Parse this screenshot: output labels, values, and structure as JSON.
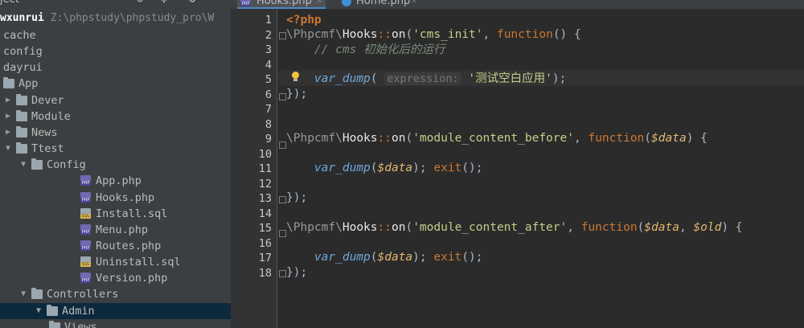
{
  "project": {
    "title": "ject",
    "root_name": "wxunrui",
    "root_path": "Z:\\phpstudy\\phpstudy_pro\\W",
    "items": [
      {
        "label": "cache",
        "kind": "none",
        "depth": 0,
        "open": false
      },
      {
        "label": "config",
        "kind": "none",
        "depth": 0,
        "open": false
      },
      {
        "label": "dayrui",
        "kind": "none",
        "depth": 0,
        "open": false
      },
      {
        "label": "App",
        "kind": "folder",
        "depth": 0,
        "open": true,
        "nochev": true
      },
      {
        "label": "Dever",
        "kind": "folder",
        "depth": 0,
        "open": false
      },
      {
        "label": "Module",
        "kind": "folder",
        "depth": 0,
        "open": false
      },
      {
        "label": "News",
        "kind": "folder",
        "depth": 0,
        "open": false
      },
      {
        "label": "Ttest",
        "kind": "folder",
        "depth": 0,
        "open": true
      },
      {
        "label": "Config",
        "kind": "folder",
        "depth": 1,
        "open": true
      },
      {
        "label": "App.php",
        "kind": "php",
        "depth": 2
      },
      {
        "label": "Hooks.php",
        "kind": "php",
        "depth": 2
      },
      {
        "label": "Install.sql",
        "kind": "sql",
        "depth": 2
      },
      {
        "label": "Menu.php",
        "kind": "php",
        "depth": 2
      },
      {
        "label": "Routes.php",
        "kind": "php",
        "depth": 2
      },
      {
        "label": "Uninstall.sql",
        "kind": "sql",
        "depth": 2
      },
      {
        "label": "Version.php",
        "kind": "php",
        "depth": 2
      },
      {
        "label": "Controllers",
        "kind": "folder",
        "depth": 1,
        "open": true
      },
      {
        "label": "Admin",
        "kind": "folder",
        "depth": 2,
        "open": true,
        "selected": true
      },
      {
        "label": "Views",
        "kind": "folder",
        "depth": 3,
        "open": false,
        "nochev": true
      }
    ]
  },
  "tabs": [
    {
      "label": "Hooks.php",
      "icon": "php-file-icon",
      "active": true
    },
    {
      "label": "Home.php",
      "icon": "php-class-icon",
      "active": false
    }
  ],
  "editor": {
    "line_numbers": [
      "1",
      "2",
      "3",
      "4",
      "5",
      "6",
      "7",
      "8",
      "9",
      "10",
      "11",
      "12",
      "13",
      "14",
      "15",
      "16",
      "17",
      "18"
    ],
    "code": {
      "php_open": "<?php",
      "ns_sep": "\\",
      "ns": "Phpcmf",
      "cls": "Hooks",
      "scope_op": "::",
      "on": "on",
      "kw_function": "function",
      "ev1": "'cms_init'",
      "comment": "// cms 初始化后的运行",
      "fn_dump": "var_dump",
      "hint": "expression:",
      "str_test": "'测试空白应用'",
      "ev2": "'module_content_before'",
      "ev3": "'module_content_after'",
      "var_data": "$data",
      "var_old": "$old",
      "fn_exit": "exit",
      "close": "});"
    }
  }
}
